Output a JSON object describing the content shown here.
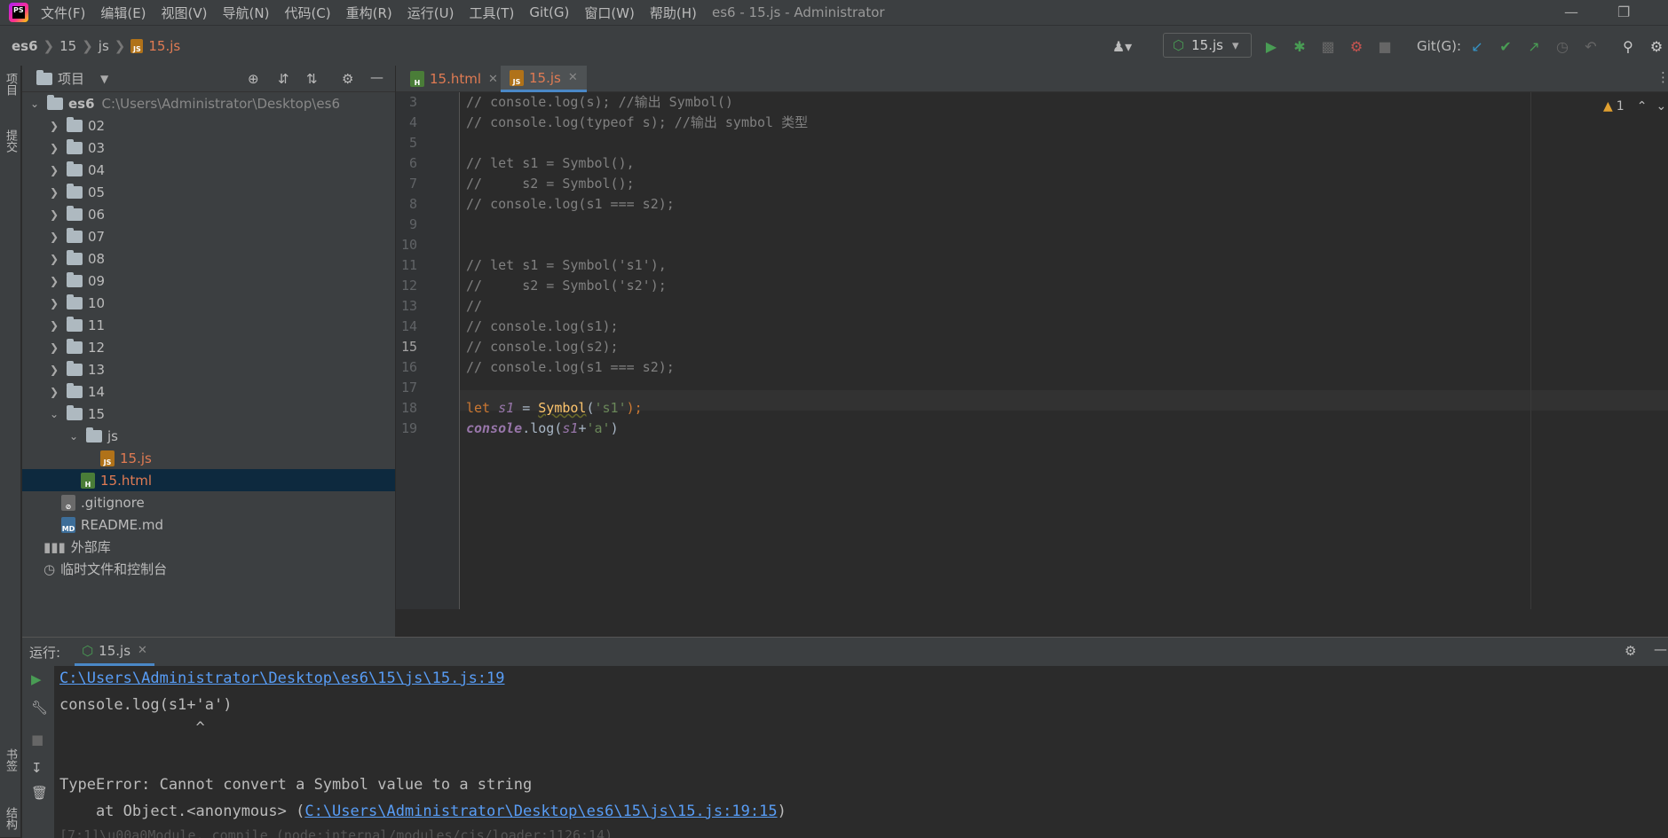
{
  "menubar": {
    "items": [
      "文件(F)",
      "编辑(E)",
      "视图(V)",
      "导航(N)",
      "代码(C)",
      "重构(R)",
      "运行(U)",
      "工具(T)",
      "Git(G)",
      "窗口(W)",
      "帮助(H)"
    ],
    "window_title": "es6 - 15.js - Administrator"
  },
  "breadcrumb": [
    "es6",
    "15",
    "js",
    "15.js"
  ],
  "toolbar": {
    "run_config": "15.js",
    "git_label": "Git(G):"
  },
  "left_strip": {
    "project_tab": "项目",
    "commit_tab": "提交",
    "bookmarks_tab": "书签",
    "structure_tab": "结构"
  },
  "project": {
    "title": "项目",
    "root_name": "es6",
    "root_path": "C:\\Users\\Administrator\\Desktop\\es6",
    "folders": [
      "02",
      "03",
      "04",
      "05",
      "06",
      "07",
      "08",
      "09",
      "10",
      "11",
      "12",
      "13",
      "14",
      "15"
    ],
    "js_folder": "js",
    "js_file": "15.js",
    "html_file": "15.html",
    "gitignore": ".gitignore",
    "readme": "README.md",
    "external_libs": "外部库",
    "scratches": "临时文件和控制台"
  },
  "editor": {
    "tabs": [
      "15.html",
      "15.js"
    ],
    "warning_count": "1",
    "lines": [
      {
        "n": "3",
        "text": "// console.log(s); //输出 Symbol()"
      },
      {
        "n": "4",
        "text": "// console.log(typeof s); //输出 symbol 类型"
      },
      {
        "n": "5",
        "text": ""
      },
      {
        "n": "6",
        "text": "// let s1 = Symbol(),"
      },
      {
        "n": "7",
        "text": "//     s2 = Symbol();"
      },
      {
        "n": "8",
        "text": "// console.log(s1 === s2);"
      },
      {
        "n": "9",
        "text": ""
      },
      {
        "n": "10",
        "text": ""
      },
      {
        "n": "11",
        "text": "// let s1 = Symbol('s1'),"
      },
      {
        "n": "12",
        "text": "//     s2 = Symbol('s2');"
      },
      {
        "n": "13",
        "text": "//"
      },
      {
        "n": "14",
        "text": "// console.log(s1);"
      },
      {
        "n": "15",
        "text": "// console.log(s2);"
      },
      {
        "n": "16",
        "text": "// console.log(s1 === s2);"
      },
      {
        "n": "17",
        "text": ""
      },
      {
        "n": "18",
        "text": ""
      },
      {
        "n": "19",
        "text": ""
      }
    ],
    "line18": {
      "kw": "let",
      "var": "s1",
      "eq": " = ",
      "fn": "Symbol",
      "open": "(",
      "str": "'s1'",
      "close": ");"
    },
    "line19": {
      "obj": "console",
      "dot": ".log(",
      "var": "s1",
      "plus": "+",
      "str": "'a'",
      "close": ")"
    }
  },
  "run": {
    "label": "运行:",
    "tab": "15.js",
    "output": {
      "path_link": "C:\\Users\\Administrator\\Desktop\\es6\\15\\js\\15.js:19",
      "code_line": "console.log(s1+'a')",
      "caret": "               ^",
      "error": "TypeError: Cannot convert a Symbol value to a string",
      "at_prefix": "    at Object.<anonymous> (",
      "at_link": "C:\\Users\\Administrator\\Desktop\\es6\\15\\js\\15.js:19:15",
      "at_suffix": ")",
      "trace_partial": "[7:1]\\u00a0Module._compile (node:internal/modules/cjs/loader:1126:14)"
    }
  },
  "colors": {
    "accent": "#4a88c7",
    "keyword": "#cc7832",
    "string": "#6a8759",
    "comment": "#808080",
    "link": "#589df6",
    "selection": "#0d293e",
    "run_green": "#499c54"
  }
}
